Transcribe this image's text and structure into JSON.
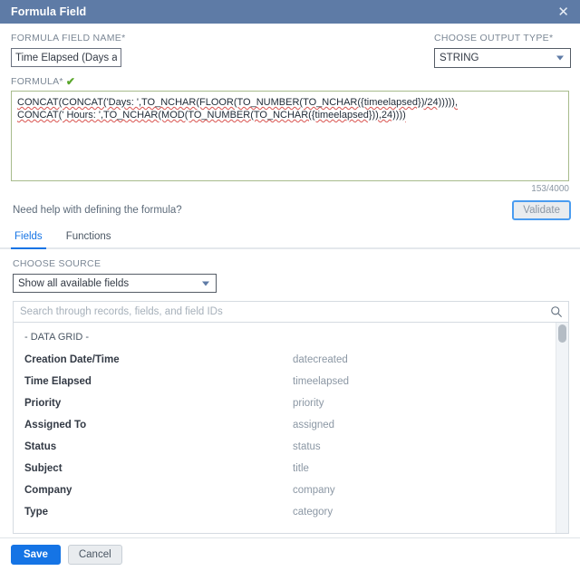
{
  "window": {
    "title": "Formula Field",
    "close_label": "✕"
  },
  "form": {
    "name_label": "FORMULA FIELD NAME*",
    "name_value": "Time Elapsed (Days a...",
    "output_type_label": "CHOOSE OUTPUT TYPE*",
    "output_type_value": "STRING"
  },
  "formula": {
    "label": "FORMULA*",
    "valid_check": "✔",
    "line1": "CONCAT(CONCAT('Days: ',TO_NCHAR(FLOOR(TO_NUMBER(TO_NCHAR({timeelapsed})/24))))),",
    "line2": "CONCAT(' Hours: ',TO_NCHAR(MOD(TO_NUMBER(TO_NCHAR({timeelapsed})),24))))",
    "counter": "153/4000"
  },
  "help": {
    "text": "Need help with defining the formula?",
    "validate_label": "Validate"
  },
  "tabs": [
    {
      "label": "Fields",
      "active": true
    },
    {
      "label": "Functions",
      "active": false
    }
  ],
  "source": {
    "label": "CHOOSE SOURCE",
    "value": "Show all available fields"
  },
  "search": {
    "placeholder": "Search through records, fields, and field IDs",
    "value": "",
    "icon": "search-icon"
  },
  "field_list": {
    "group_label": "- DATA GRID -",
    "rows": [
      {
        "label": "Creation Date/Time",
        "id": "datecreated"
      },
      {
        "label": "Time Elapsed",
        "id": "timeelapsed"
      },
      {
        "label": "Priority",
        "id": "priority"
      },
      {
        "label": "Assigned To",
        "id": "assigned"
      },
      {
        "label": "Status",
        "id": "status"
      },
      {
        "label": "Subject",
        "id": "title"
      },
      {
        "label": "Company",
        "id": "company"
      },
      {
        "label": "Type",
        "id": "category"
      }
    ]
  },
  "footer": {
    "save_label": "Save",
    "cancel_label": "Cancel"
  },
  "colors": {
    "titlebar": "#5e7ba6",
    "accent": "#1574e5",
    "formula_border": "#a8bb8c",
    "valid_check": "#5aa72c"
  }
}
